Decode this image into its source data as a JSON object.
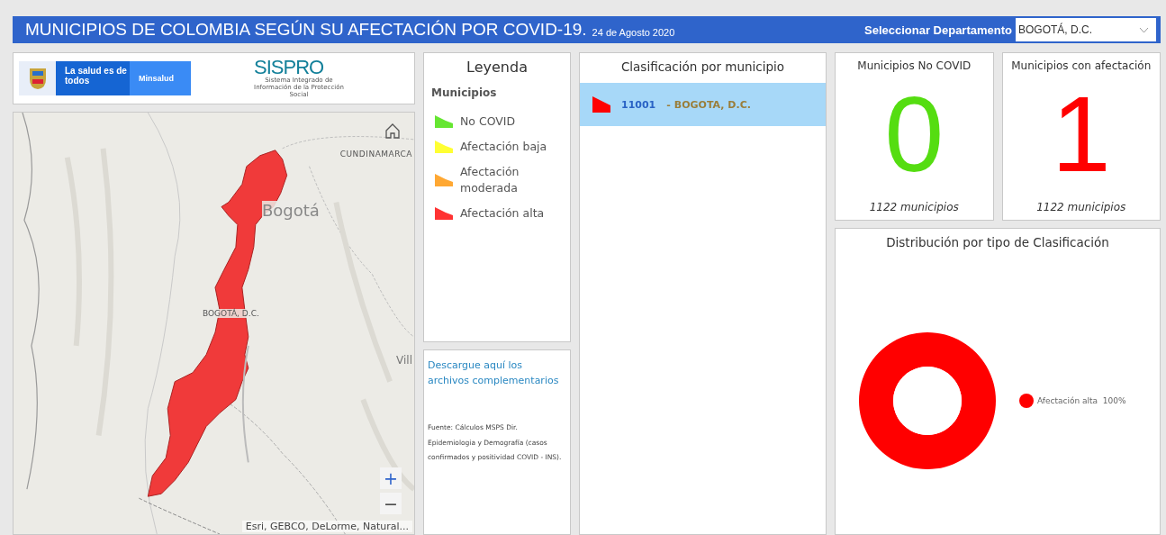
{
  "header": {
    "title": "MUNICIPIOS DE COLOMBIA SEGÚN SU AFECTACIÓN POR COVID-19.",
    "date": "24 de Agosto 2020",
    "selector_label": "Seleccionar Departamento",
    "selector_value": "BOGOTÁ, D.C."
  },
  "logos": {
    "tagline": "La salud es de todos",
    "ministry": "Minsalud",
    "sispro": "SISPRO",
    "sispro_subtitle": "Sistema Integrado de Información de la Protección Social"
  },
  "map": {
    "labels": [
      "CUNDINAMARCA",
      "Bogotá",
      "BOGOTÁ, D.C.",
      "Vill"
    ],
    "attribution": "Esri, GEBCO, DeLorme, Natural...",
    "zoom_in": "+",
    "zoom_out": "−"
  },
  "legend": {
    "title": "Leyenda",
    "subtitle": "Municipios",
    "items": [
      {
        "label": "No COVID",
        "color": "#66e632"
      },
      {
        "label": "Afectación baja",
        "color": "#ffff33"
      },
      {
        "label": "Afectación moderada",
        "color": "#ffa833"
      },
      {
        "label": "Afectación alta",
        "color": "#ff3333"
      }
    ]
  },
  "download": {
    "link": "Descargue aquí los archivos complementarios",
    "source": "Fuente: Cálculos MSPS Dir. Epidemiologia y Demografía (casos confirmados y positividad COVID - INS)."
  },
  "classification": {
    "title": "Clasificación por municipio",
    "rows": [
      {
        "code": "11001",
        "separator": "-",
        "name": "BOGOTA, D.C.",
        "color": "#ff0000",
        "selected": true
      }
    ]
  },
  "stats": [
    {
      "title": "Municipios No COVID",
      "value": "0",
      "caption": "1122 municipios",
      "color": "#55dd11"
    },
    {
      "title": "Municipios con afectación",
      "value": "1",
      "caption": "1122 municipios",
      "color": "#ff0000"
    }
  ],
  "distribution": {
    "title": "Distribución por tipo de Clasificación",
    "chart_data": {
      "type": "donut",
      "series": [
        {
          "name": "Afectación alta",
          "color": "#ff0000",
          "values": [
            100
          ]
        }
      ],
      "value_labels": [
        "100%"
      ]
    }
  }
}
